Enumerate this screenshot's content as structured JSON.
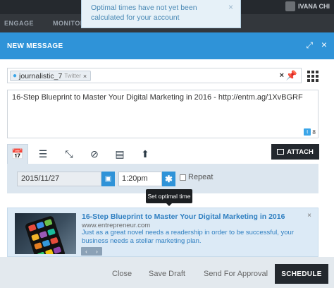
{
  "app": {
    "nav": [
      "ENGAGE",
      "MONITOR"
    ],
    "user_name": "IVANA CHI"
  },
  "toast": {
    "message": "Optimal times have not yet been calculated for your account",
    "close": "×"
  },
  "modal": {
    "title": "NEW MESSAGE",
    "expand_icon": "expand-icon",
    "close_icon": "close-icon"
  },
  "profile": {
    "name": "journalistic_7",
    "network": "Twitter",
    "remove": "×",
    "clear": "×"
  },
  "message": {
    "text": "16-Step Blueprint to Master Your Digital Marketing in 2016 - http://entm.ag/1XvBGRF",
    "char_count": "8"
  },
  "tools": [
    "calendar-icon",
    "list-icon",
    "shortcode-icon",
    "link-icon",
    "book-icon",
    "upload-icon"
  ],
  "attach": {
    "label": "ATTACH"
  },
  "schedule": {
    "date": "2015/11/27",
    "time": "1:20pm",
    "repeat_label": "Repeat",
    "tooltip": "Set optimal time"
  },
  "link_preview": {
    "title": "16-Step Blueprint to Master Your Digital Marketing in 2016",
    "url": "www.entrepreneur.com",
    "description": "Just as a great novel needs a readership in order to be successful, your business needs a stellar marketing plan.",
    "nav_prev": "‹",
    "nav_next": "›",
    "close": "×"
  },
  "footer": {
    "close": "Close",
    "save_draft": "Save Draft",
    "send_approval": "Send For Approval",
    "schedule": "SCHEDULE"
  },
  "colors": {
    "primary": "#2f93d8",
    "dark_button": "#23282e",
    "panel": "#dce6ef",
    "link": "#2f7fc1"
  }
}
